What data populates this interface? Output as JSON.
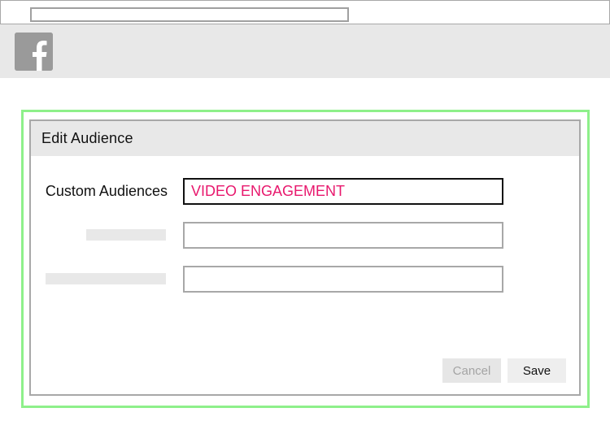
{
  "browser": {
    "address_value": ""
  },
  "header": {
    "logo_icon": "facebook-f-icon",
    "logo_color": "#9a9a9a"
  },
  "dialog": {
    "title": "Edit Audience",
    "fields": [
      {
        "label": "Custom Audiences",
        "value": "VIDEO ENGAGEMENT"
      },
      {
        "label": "",
        "value": ""
      },
      {
        "label": "",
        "value": ""
      }
    ],
    "buttons": {
      "cancel_label": "Cancel",
      "save_label": "Save"
    }
  },
  "colors": {
    "highlight_frame": "#8ef08a",
    "active_value_text": "#e8186d",
    "panel_grey": "#e8e8e8"
  }
}
